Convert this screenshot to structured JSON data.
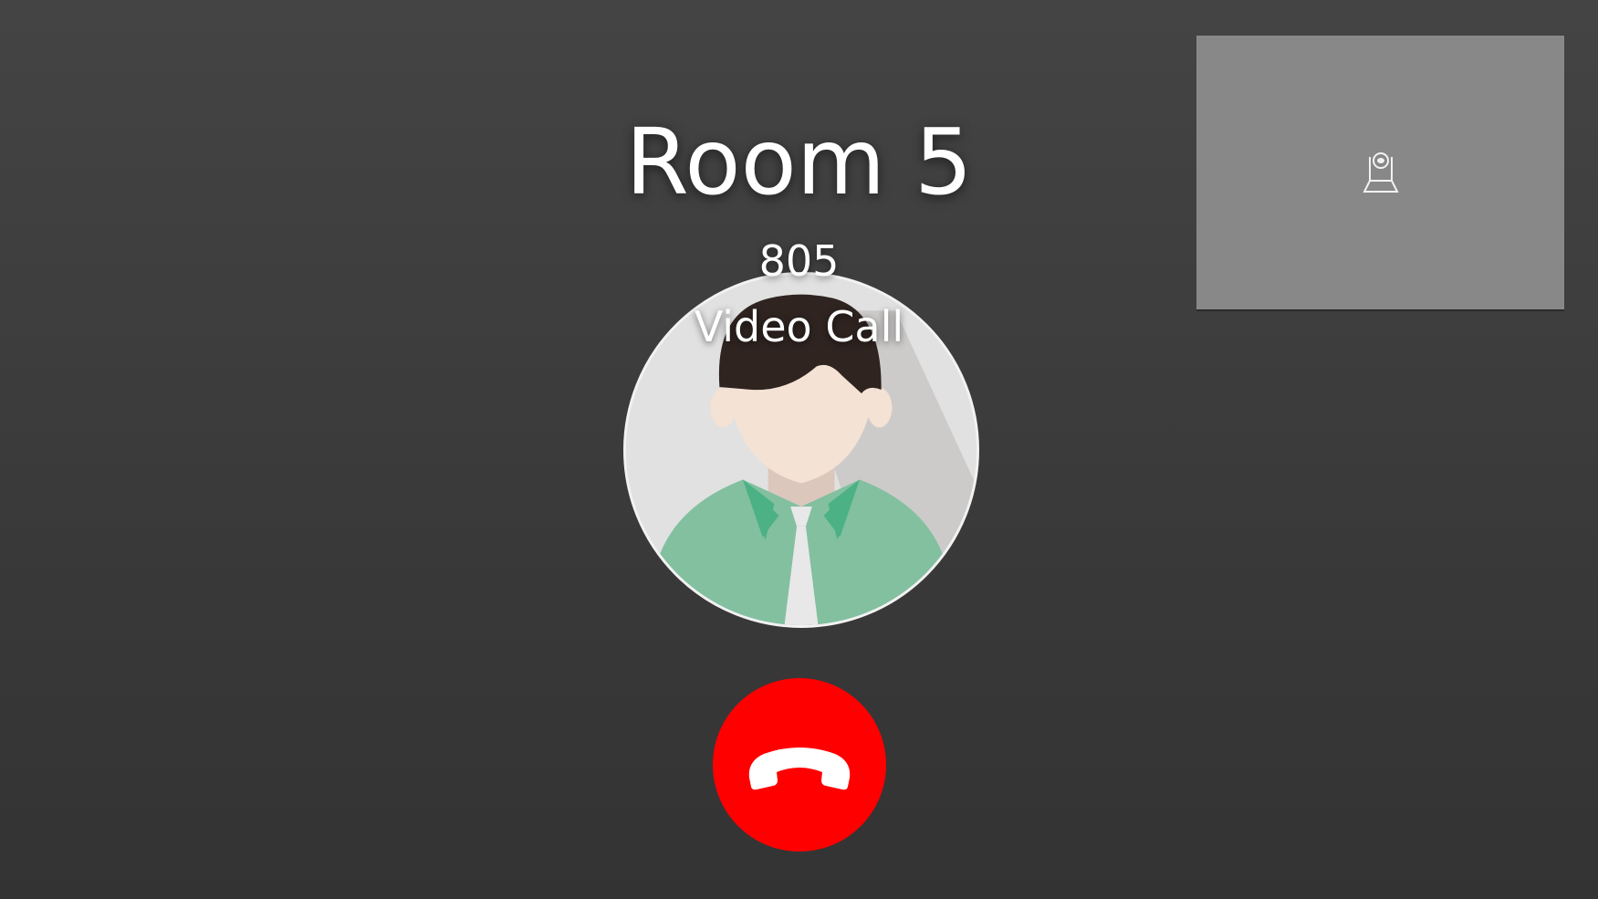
{
  "call": {
    "contact_name": "Room 5",
    "contact_number": "805",
    "call_type": "Video Call"
  },
  "icons": {
    "avatar": "person-avatar",
    "hangup": "phone-hangup-icon",
    "self_preview": "webcam-icon"
  },
  "colors": {
    "background_top": "#444444",
    "background_bottom": "#333333",
    "hangup": "#ff0000",
    "self_preview": "#888889",
    "text": "#ffffff"
  }
}
